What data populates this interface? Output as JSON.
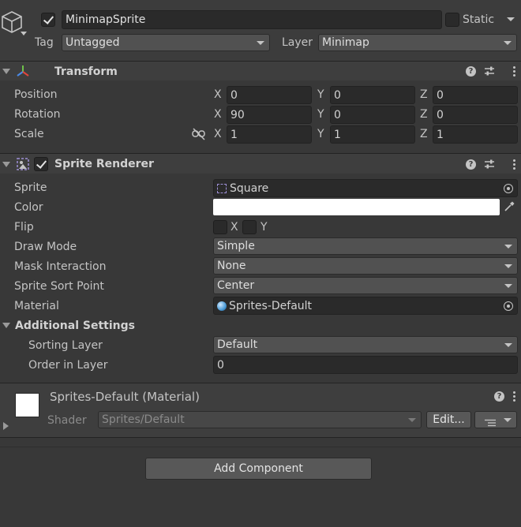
{
  "gameobject": {
    "active": true,
    "name": "MinimapSprite",
    "static_label": "Static",
    "static_checked": false,
    "tag_label": "Tag",
    "tag_value": "Untagged",
    "layer_label": "Layer",
    "layer_value": "Minimap",
    "icon": "cube-icon"
  },
  "transform": {
    "title": "Transform",
    "icon": "transform-axes-icon",
    "rows": [
      {
        "label": "Position",
        "x": "0",
        "y": "0",
        "z": "0"
      },
      {
        "label": "Rotation",
        "x": "90",
        "y": "0",
        "z": "0"
      },
      {
        "label": "Scale",
        "x": "1",
        "y": "1",
        "z": "1"
      }
    ],
    "axis_x": "X",
    "axis_y": "Y",
    "axis_z": "Z"
  },
  "sprite_renderer": {
    "title": "Sprite Renderer",
    "enabled": true,
    "icon": "sprite-renderer-icon",
    "sprite_label": "Sprite",
    "sprite_value": "Square",
    "color_label": "Color",
    "color_value": "#ffffff",
    "flip_label": "Flip",
    "flip_x": "X",
    "flip_y": "Y",
    "draw_mode_label": "Draw Mode",
    "draw_mode_value": "Simple",
    "mask_label": "Mask Interaction",
    "mask_value": "None",
    "sort_point_label": "Sprite Sort Point",
    "sort_point_value": "Center",
    "material_label": "Material",
    "material_value": "Sprites-Default",
    "additional_label": "Additional Settings",
    "sorting_layer_label": "Sorting Layer",
    "sorting_layer_value": "Default",
    "order_label": "Order in Layer",
    "order_value": "0"
  },
  "material": {
    "title": "Sprites-Default (Material)",
    "shader_label": "Shader",
    "shader_value": "Sprites/Default",
    "edit_label": "Edit..."
  },
  "add_component_label": "Add Component",
  "colors": {
    "background": "#383838",
    "field": "#2a2a2a",
    "header": "#3e3e3e"
  }
}
